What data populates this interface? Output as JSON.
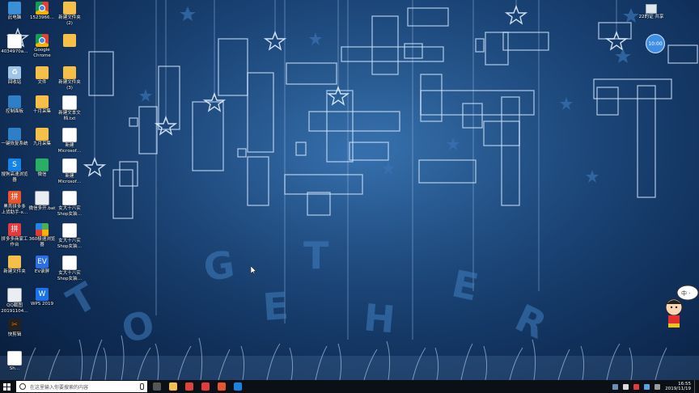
{
  "desktop": {
    "icons": [
      {
        "label": "此电脑",
        "glyph": "",
        "kind": "g-pc",
        "name": "desktop-icon-this-pc"
      },
      {
        "label": "1523966…",
        "glyph": "",
        "kind": "g-chrome",
        "name": "desktop-icon-1523966"
      },
      {
        "label": "新建文件夹\n(2)",
        "glyph": "",
        "kind": "g-folder",
        "name": "desktop-icon-new-folder-2"
      },
      {
        "label": "4034970a…",
        "glyph": "",
        "kind": "g-doc",
        "name": "desktop-icon-4034970a"
      },
      {
        "label": "Google\nChrome",
        "glyph": "",
        "kind": "g-chrome",
        "name": "desktop-icon-google-chrome"
      },
      {
        "label": "",
        "glyph": "",
        "kind": "g-folder",
        "name": "desktop-icon-folder-blank"
      },
      {
        "label": "回收站",
        "glyph": "♻",
        "kind": "g-recycle",
        "name": "desktop-icon-recycle-bin"
      },
      {
        "label": "文件",
        "glyph": "",
        "kind": "g-folder",
        "name": "desktop-icon-files"
      },
      {
        "label": "新建文件夹\n(3)",
        "glyph": "",
        "kind": "g-folder",
        "name": "desktop-icon-new-folder-3"
      },
      {
        "label": "控制面板",
        "glyph": "",
        "kind": "g-panel",
        "name": "desktop-icon-control-panel"
      },
      {
        "label": "十月采集",
        "glyph": "",
        "kind": "g-folder",
        "name": "desktop-icon-october"
      },
      {
        "label": "新建文本文\n档.txt",
        "glyph": "",
        "kind": "g-doc",
        "name": "desktop-icon-new-text-doc"
      },
      {
        "label": "一键恢复系统",
        "glyph": "",
        "kind": "g-panel",
        "name": "desktop-icon-restore-system"
      },
      {
        "label": "九月采集",
        "glyph": "",
        "kind": "g-folder",
        "name": "desktop-icon-september"
      },
      {
        "label": "新建\nMicrosof…",
        "glyph": "",
        "kind": "g-doc",
        "name": "desktop-icon-new-microsoft-1"
      },
      {
        "label": "搜狗高速浏览\n器",
        "glyph": "S",
        "kind": "g-sogou",
        "name": "desktop-icon-sogou-browser"
      },
      {
        "label": "微信",
        "glyph": "",
        "kind": "g-green",
        "name": "desktop-icon-wechat"
      },
      {
        "label": "新建\nMicrosof…",
        "glyph": "",
        "kind": "g-doc",
        "name": "desktop-icon-new-microsoft-2"
      },
      {
        "label": "黑壳拼多多\n上货助手-x…",
        "glyph": "拼",
        "kind": "g-orange",
        "name": "desktop-icon-pdd-helper"
      },
      {
        "label": "微信多开.bat",
        "glyph": "",
        "kind": "g-img",
        "name": "desktop-icon-wechat-multi"
      },
      {
        "label": "女大十八实\nShop女装…",
        "glyph": "",
        "kind": "g-doc",
        "name": "desktop-icon-shop-1"
      },
      {
        "label": "拼多多商家工\n作台",
        "glyph": "拼",
        "kind": "g-red",
        "name": "desktop-icon-pdd-merchant"
      },
      {
        "label": "360极速浏览\n器",
        "glyph": "",
        "kind": "g-360",
        "name": "desktop-icon-360-browser"
      },
      {
        "label": "女大十八实\nShop女装…",
        "glyph": "",
        "kind": "g-doc",
        "name": "desktop-icon-shop-2"
      },
      {
        "label": "新建文件夹",
        "glyph": "",
        "kind": "g-folder",
        "name": "desktop-icon-new-folder"
      },
      {
        "label": "EV录屏",
        "glyph": "EV",
        "kind": "g-ev",
        "name": "desktop-icon-ev-recorder"
      },
      {
        "label": "女大十八实\nShop女装…",
        "glyph": "",
        "kind": "g-doc",
        "name": "desktop-icon-shop-3"
      },
      {
        "label": "QQ截图\n20191104…",
        "glyph": "",
        "kind": "g-img",
        "name": "desktop-icon-qq-screenshot"
      },
      {
        "label": "WPS 2019",
        "glyph": "W",
        "kind": "g-wps",
        "name": "desktop-icon-wps"
      },
      {
        "label": "快剪辑",
        "glyph": "✂",
        "kind": "g-black",
        "name": "desktop-icon-kuaijianji"
      },
      {
        "label": "Sh…",
        "glyph": "",
        "kind": "g-doc",
        "name": "desktop-icon-sh"
      }
    ]
  },
  "top_right": {
    "label": "22的证\n共享",
    "clock_widget": "10:00"
  },
  "wallpaper": {
    "word": "TOGETHER",
    "letters": [
      "T",
      "O",
      "G",
      "E",
      "T",
      "H",
      "E",
      "R"
    ]
  },
  "mascot": {
    "bubble": "中 ·"
  },
  "taskbar": {
    "search_placeholder": "在这里输入你要搜索的内容",
    "pinned": [
      {
        "name": "task-view-button",
        "color": "#555555"
      },
      {
        "name": "file-explorer-button",
        "color": "#f5c04a"
      },
      {
        "name": "chrome-taskbar-button",
        "color": "#db4437"
      },
      {
        "name": "pdd-taskbar-button-1",
        "color": "#e33b3b"
      },
      {
        "name": "pdd-taskbar-button-2",
        "color": "#e8542b"
      },
      {
        "name": "sogou-taskbar-button",
        "color": "#1684e6"
      }
    ],
    "time": "16:55",
    "date": "2019/11/19"
  }
}
